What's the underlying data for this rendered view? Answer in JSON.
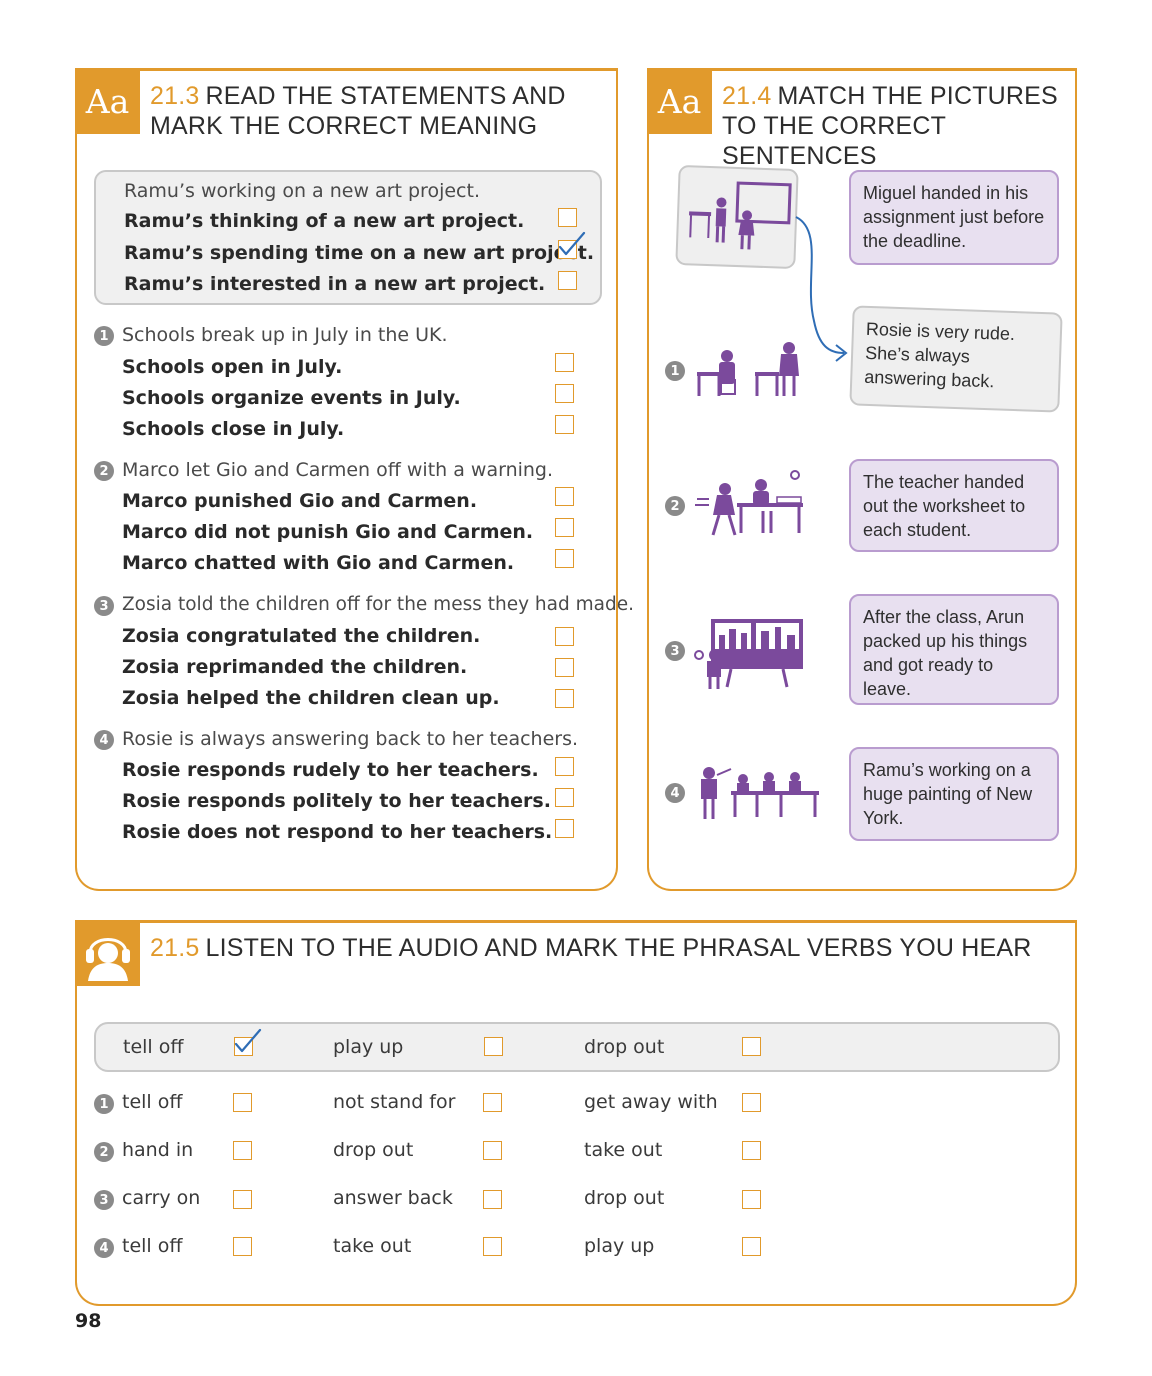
{
  "ex213": {
    "badge": "Aa",
    "number": "21.3",
    "title_line1": "READ THE STATEMENTS AND",
    "title_line2": "MARK THE CORRECT MEANING",
    "example": {
      "statement": "Ramu’s working on a new art project.",
      "options": [
        {
          "text": "Ramu’s thinking of a new art project.",
          "checked": false
        },
        {
          "text": "Ramu’s spending time on a new art project.",
          "checked": true
        },
        {
          "text": "Ramu’s interested in a new art project.",
          "checked": false
        }
      ]
    },
    "items": [
      {
        "num": "1",
        "statement": "Schools break up in July in the UK.",
        "options": [
          "Schools open in July.",
          "Schools organize events in July.",
          "Schools close in July."
        ]
      },
      {
        "num": "2",
        "statement": "Marco let Gio and Carmen off with a warning.",
        "options": [
          "Marco punished Gio and Carmen.",
          "Marco did not punish Gio and Carmen.",
          "Marco chatted with Gio and Carmen."
        ]
      },
      {
        "num": "3",
        "statement": "Zosia told the children off for the mess they had made.",
        "options": [
          "Zosia congratulated the children.",
          "Zosia reprimanded the children.",
          "Zosia helped the children clean up."
        ]
      },
      {
        "num": "4",
        "statement": "Rosie is always answering back to her teachers.",
        "options": [
          "Rosie responds rudely to her teachers.",
          "Rosie responds politely to her teachers.",
          "Rosie does not respond to her teachers."
        ]
      }
    ]
  },
  "ex214": {
    "badge": "Aa",
    "number": "21.4",
    "title_line1": "MATCH THE PICTURES",
    "title_line2": "TO THE CORRECT SENTENCES",
    "sentences": [
      "Miguel handed in his assignment just before the deadline.",
      "Rosie is very rude. She’s always answering back.",
      "The teacher handed out the worksheet to each student.",
      "After the class, Arun packed up his things and got ready to leave.",
      "Ramu’s working on a huge painting of New York."
    ],
    "picture_numbers": [
      "1",
      "2",
      "3",
      "4"
    ]
  },
  "ex215": {
    "number": "21.5",
    "title": "LISTEN TO THE AUDIO AND MARK THE PHRASAL VERBS YOU HEAR",
    "example": {
      "words": [
        "tell off",
        "play up",
        "drop out"
      ],
      "checked_index": 0
    },
    "rows": [
      {
        "num": "1",
        "words": [
          "tell off",
          "not stand for",
          "get away with"
        ]
      },
      {
        "num": "2",
        "words": [
          "hand in",
          "drop out",
          "take out"
        ]
      },
      {
        "num": "3",
        "words": [
          "carry on",
          "answer back",
          "drop out"
        ]
      },
      {
        "num": "4",
        "words": [
          "tell off",
          "take out",
          "play up"
        ]
      }
    ]
  },
  "page_number": "98",
  "colors": {
    "accent": "#e19a2c",
    "purple": "#7b4a9c",
    "purple_light": "#e8e0f0",
    "tick": "#2f6db5"
  }
}
